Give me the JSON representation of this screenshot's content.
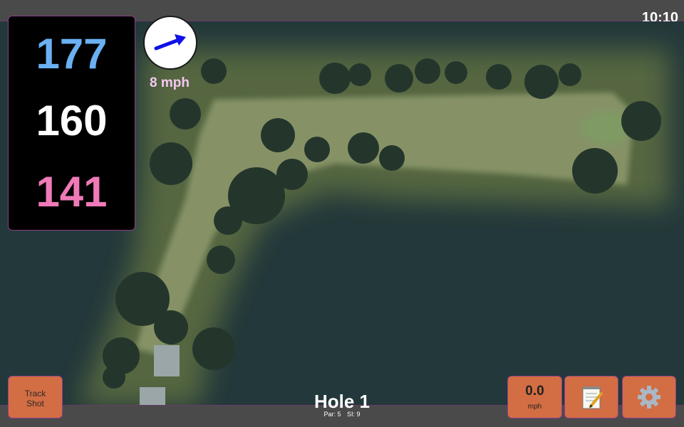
{
  "status": {
    "time": "10:10"
  },
  "distances": {
    "back": "177",
    "middle": "160",
    "front": "141"
  },
  "wind": {
    "speed_label": "8 mph",
    "arrow_icon": "wind-direction-arrow-icon"
  },
  "buttons": {
    "track_shot": "Track\nShot",
    "speed_value": "0.0",
    "speed_unit": "mph",
    "notes_icon": "notepad-icon",
    "settings_icon": "gear-icon"
  },
  "hole": {
    "title": "Hole 1",
    "par": "Par: 5",
    "si": "SI: 9"
  },
  "colors": {
    "back_distance": "#6ab0f2",
    "middle_distance": "#ffffff",
    "front_distance": "#f07ab8",
    "button": "#d36d43",
    "border_accent": "#8c3f8c"
  }
}
